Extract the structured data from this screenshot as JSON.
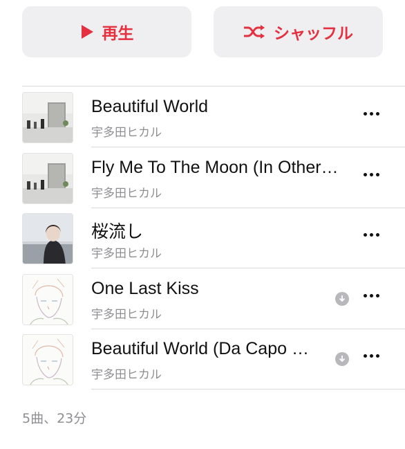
{
  "buttons": {
    "play_label": "再生",
    "shuffle_label": "シャッフル"
  },
  "tracks": [
    {
      "title": "Beautiful World",
      "artist": "宇多田ヒカル",
      "downloadable": false,
      "artwork": "street-scene-artwork"
    },
    {
      "title": "Fly Me To The Moon (In Other Words)",
      "artist": "宇多田ヒカル",
      "downloadable": false,
      "artwork": "street-scene-artwork"
    },
    {
      "title": "桜流し",
      "artist": "宇多田ヒカル",
      "downloadable": false,
      "artwork": "portrait-artwork"
    },
    {
      "title": "One Last Kiss",
      "artist": "宇多田ヒカル",
      "downloadable": true,
      "artwork": "line-drawing-artwork"
    },
    {
      "title": "Beautiful World (Da Capo Version)",
      "artist": "宇多田ヒカル",
      "downloadable": true,
      "artwork": "line-drawing-artwork"
    }
  ],
  "footer": {
    "summary": "5曲、23分"
  },
  "colors": {
    "accent": "#e4303f",
    "button_bg": "#efeff1",
    "secondary_text": "#8e8e93",
    "separator": "#d9d9dc"
  }
}
